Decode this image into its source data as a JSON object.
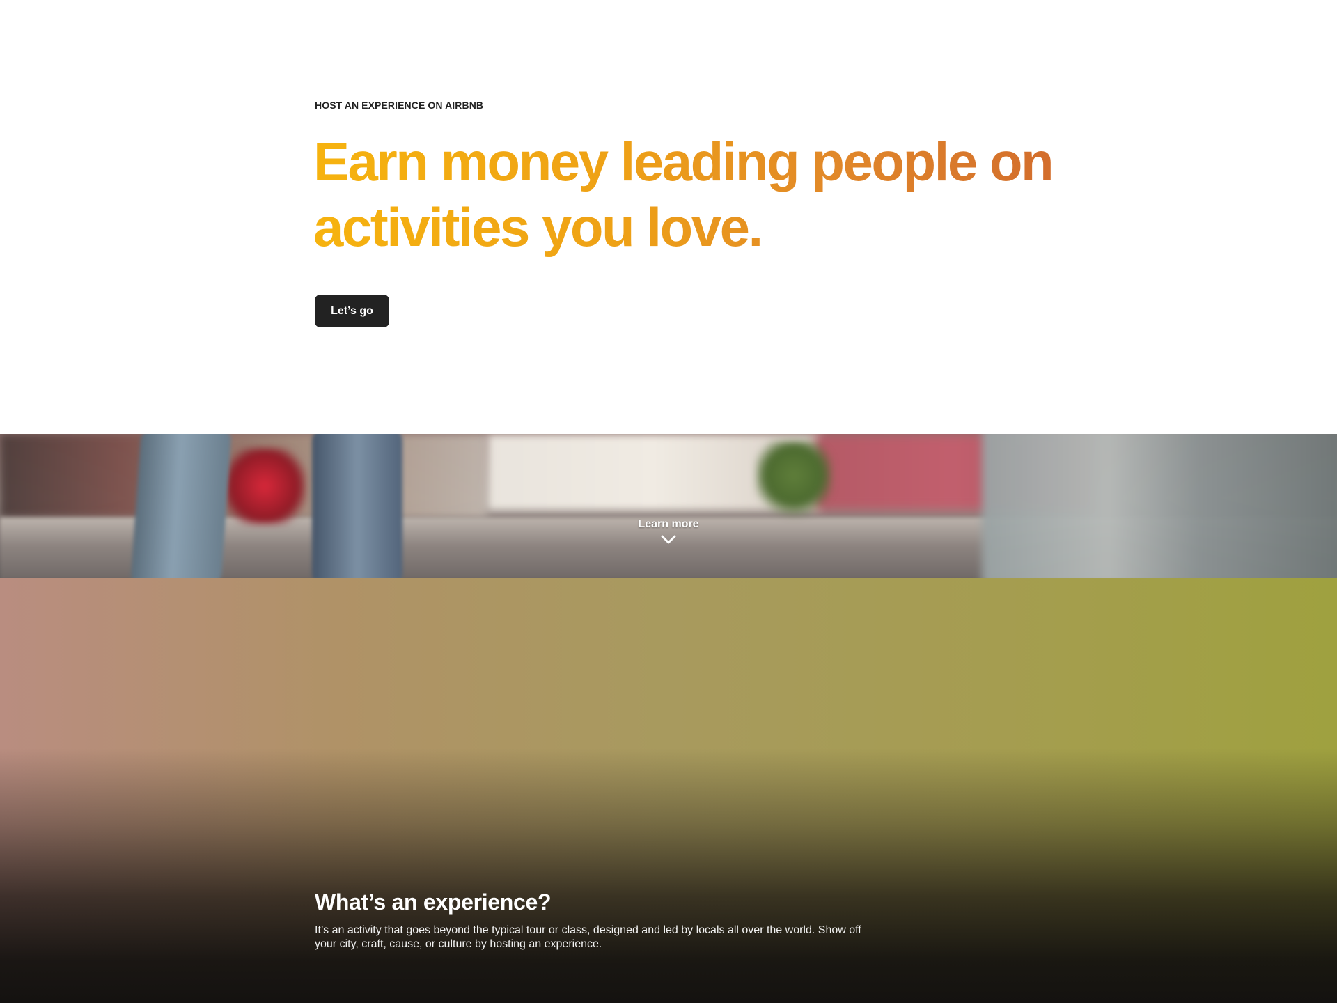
{
  "hero": {
    "eyebrow": "HOST AN EXPERIENCE ON AIRBNB",
    "headline": "Earn money leading people on activities you love.",
    "cta_label": "Let’s go",
    "headline_gradient": [
      "#f6b30f",
      "#d16a2c"
    ],
    "cta_color": "#222222"
  },
  "video": {
    "learn_more_label": "Learn more",
    "learn_more_icon": "chevron-down-icon"
  },
  "experience": {
    "title": "What’s an experience?",
    "description": "It’s an activity that goes beyond the typical tour or class, designed and led by locals all over the world. Show off your city, craft, cause, or culture by hosting an experience."
  }
}
